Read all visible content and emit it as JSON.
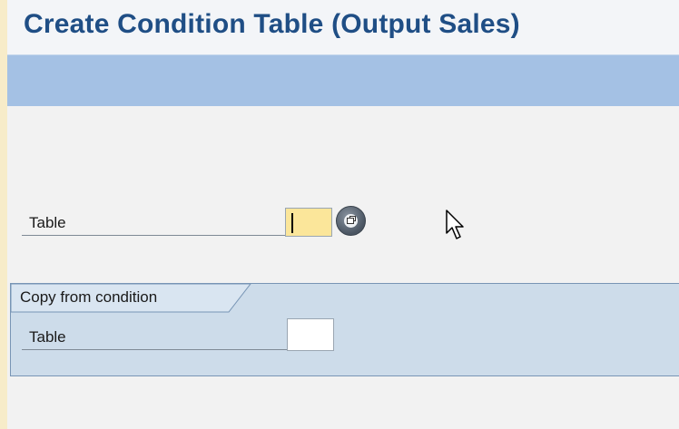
{
  "title_bar": {
    "title": "Create Condition Table (Output Sales)"
  },
  "form": {
    "table_field": {
      "label": "Table",
      "value": ""
    },
    "copy_group": {
      "title": "Copy from condition",
      "table_field": {
        "label": "Table",
        "value": ""
      }
    }
  },
  "icons": {
    "value_help": "value-help-icon",
    "cursor": "mouse-pointer-icon"
  },
  "colors": {
    "title_text": "#1f4e85",
    "toolbar": "#a4c1e4",
    "required_field": "#fbe69a",
    "group_box": "#cddcea",
    "background": "#f2f2f2"
  }
}
